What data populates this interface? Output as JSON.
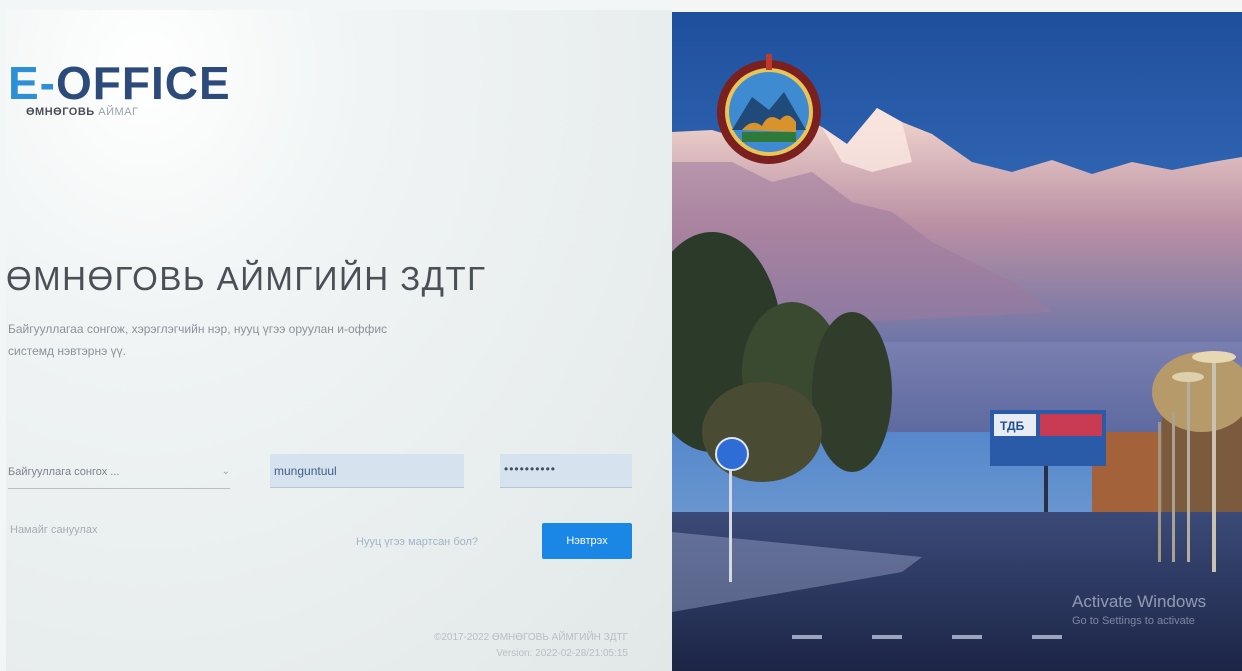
{
  "brand": {
    "logo_prefix": "E-",
    "logo_main": "OFFICE",
    "subtitle_bold": "ӨМНӨГОВЬ",
    "subtitle_light": "АЙМАГ"
  },
  "login": {
    "title": "ӨМНӨГОВЬ АЙМГИЙН ЗДТГ",
    "instructions_line1": "Байгууллагаа сонгож, хэрэглэгчийн нэр, нууц үгээ оруулан и-оффис",
    "instructions_line2": "системд нэвтэрнэ үү.",
    "org_select_value": "Байгууллага сонгох ...",
    "username_value": "munguntuul",
    "password_mask": "••••••••••",
    "remember_label": "Намайг сануулах",
    "forgot_link": "Нууц үгээ мартсан бол?",
    "login_button": "Нэвтрэх"
  },
  "footer": {
    "line1": "©2017-2022 ӨМНӨГОВЬ АЙМГИЙН ЗДТГ",
    "line2": "Version: 2022-02-28/21:05:15"
  },
  "background": {
    "billboard_text": "ТДБ"
  },
  "windows_watermark": {
    "title": "Activate Windows",
    "subtitle": "Go to Settings to activate"
  },
  "colors": {
    "brand_dark": "#2c4a7a",
    "brand_accent": "#2d8fd6",
    "button": "#1a86e6",
    "input_bg": "#d6e3ef"
  }
}
